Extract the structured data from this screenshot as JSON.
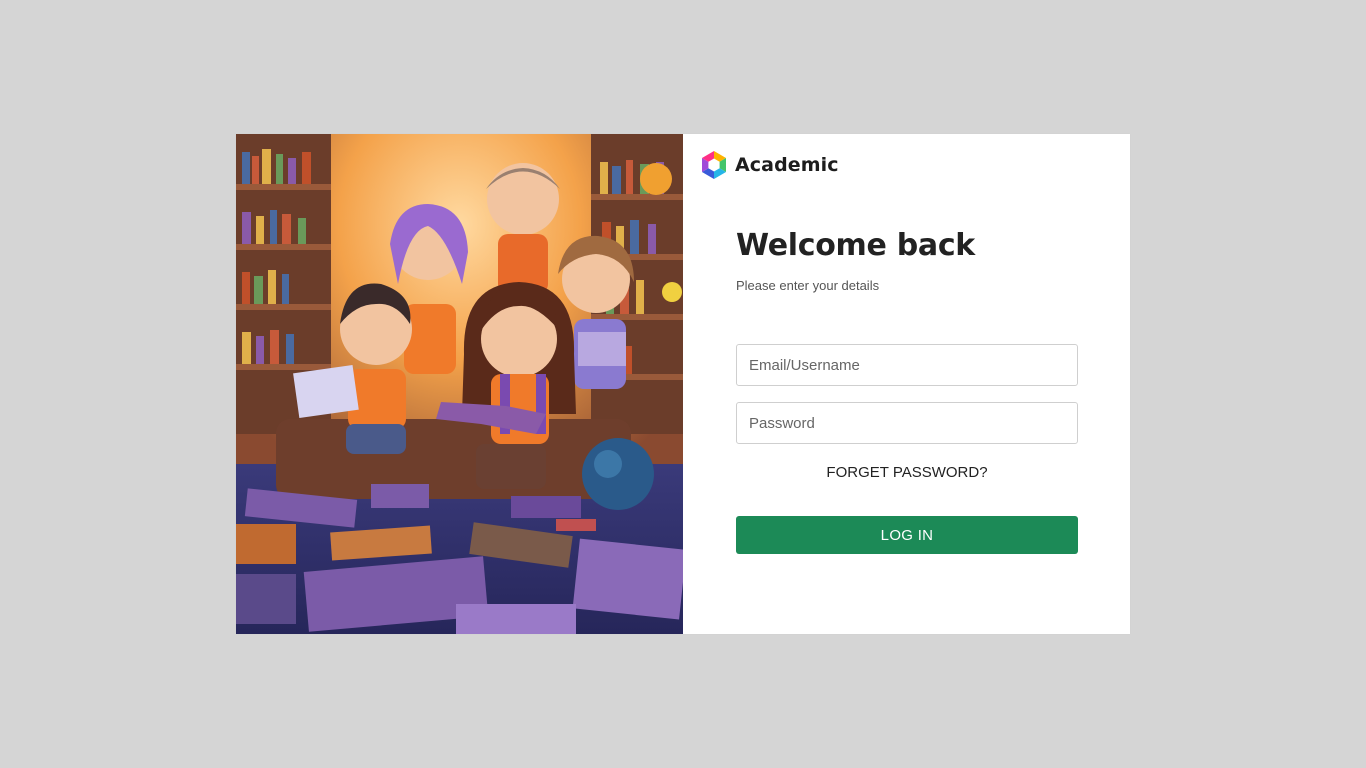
{
  "brand": {
    "name": "Academic",
    "logo_icon": "hexagon-gradient-logo-icon"
  },
  "hero": {
    "icon": "children-reading-in-library-illustration",
    "colors": {
      "background_glow": "#f4a24a",
      "shelf_wood": "#7a4a32",
      "floor_rug": "#2f2f6e",
      "book_purple": "#7b5ba8",
      "shirt_orange": "#f07a2a"
    }
  },
  "login": {
    "heading": "Welcome back",
    "subtitle": "Please enter your details",
    "email": {
      "placeholder": "Email/Username",
      "value": ""
    },
    "password": {
      "placeholder": "Password",
      "value": ""
    },
    "forgot_label": "FORGET PASSWORD?",
    "submit_label": "LOG IN"
  },
  "colors": {
    "page_background": "#d5d5d5",
    "card_background": "#ffffff",
    "primary_button": "#1c8a57",
    "heading_text": "#222222"
  }
}
